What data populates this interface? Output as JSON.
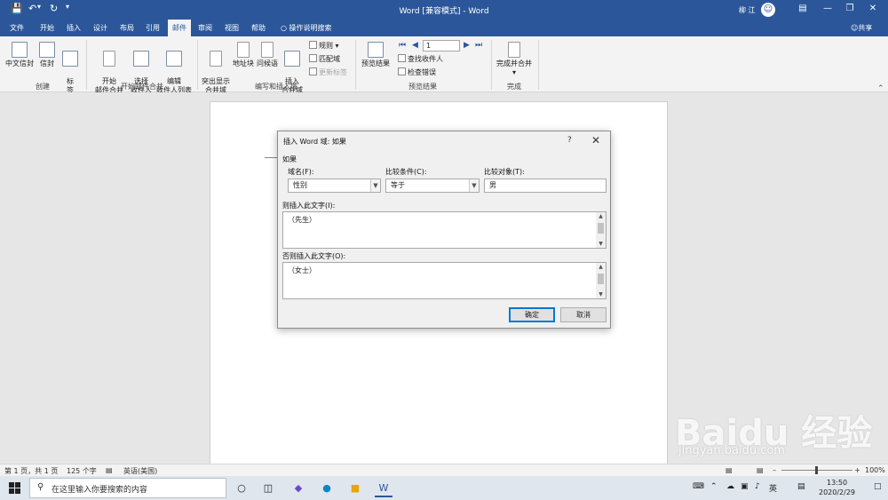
{
  "window": {
    "title": "Word [兼容模式] - Word",
    "user_name": "柳 江"
  },
  "tabs": {
    "items": [
      "文件",
      "开始",
      "插入",
      "设计",
      "布局",
      "引用",
      "邮件",
      "审阅",
      "视图",
      "帮助"
    ],
    "active": "邮件",
    "tell_me": "操作说明搜索",
    "share": "共享"
  },
  "ribbon": {
    "create": {
      "group": "创建",
      "chinese_envelope": "中文信封",
      "envelope": "信封",
      "labels": "标\n签"
    },
    "start_merge": {
      "group": "开始邮件合并",
      "start_mail_merge": "开始\n邮件合并",
      "select_recipients": "选择\n收件人",
      "edit_recipient_list": "编辑\n收件人列表"
    },
    "write_insert": {
      "group": "编写和插入域",
      "highlight_merge_fields": "突出显示\n合并域",
      "address_block": "地址块",
      "greeting_line": "问候语",
      "insert_merge_field": "插入\n合并域",
      "rules": "规则",
      "match_fields": "匹配域",
      "update_labels": "更新标签"
    },
    "preview": {
      "group": "预览结果",
      "preview_results": "预览结果",
      "record_number": "1",
      "find_recipient": "查找收件人",
      "check_errors": "检查错误"
    },
    "finish": {
      "group": "完成",
      "finish_merge": "完成并合并"
    }
  },
  "dialog": {
    "title": "插入 Word 域: 如果",
    "help": "?",
    "section_if": "如果",
    "field_name_label": "域名(F):",
    "field_name_value": "性别",
    "comparison_label": "比较条件(C):",
    "comparison_value": "等于",
    "compare_to_label": "比较对象(T):",
    "compare_to_value": "男",
    "insert_text_label": "则插入此文字(I):",
    "insert_text_value": "（先生）",
    "otherwise_text_label": "否则插入此文字(O):",
    "otherwise_text_value": "（女士）",
    "ok": "确定",
    "cancel": "取消"
  },
  "statusbar": {
    "page": "第 1 页，共 1 页",
    "words": "125 个字",
    "language": "英语(美国)",
    "zoom": "100%"
  },
  "taskbar": {
    "search_placeholder": "在这里输入你要搜索的内容",
    "ime": "英",
    "time": "13:50",
    "date": "2020/2/29"
  },
  "watermark": {
    "brand": "Baidu 经验",
    "url": "jingyan.baidu.com"
  }
}
